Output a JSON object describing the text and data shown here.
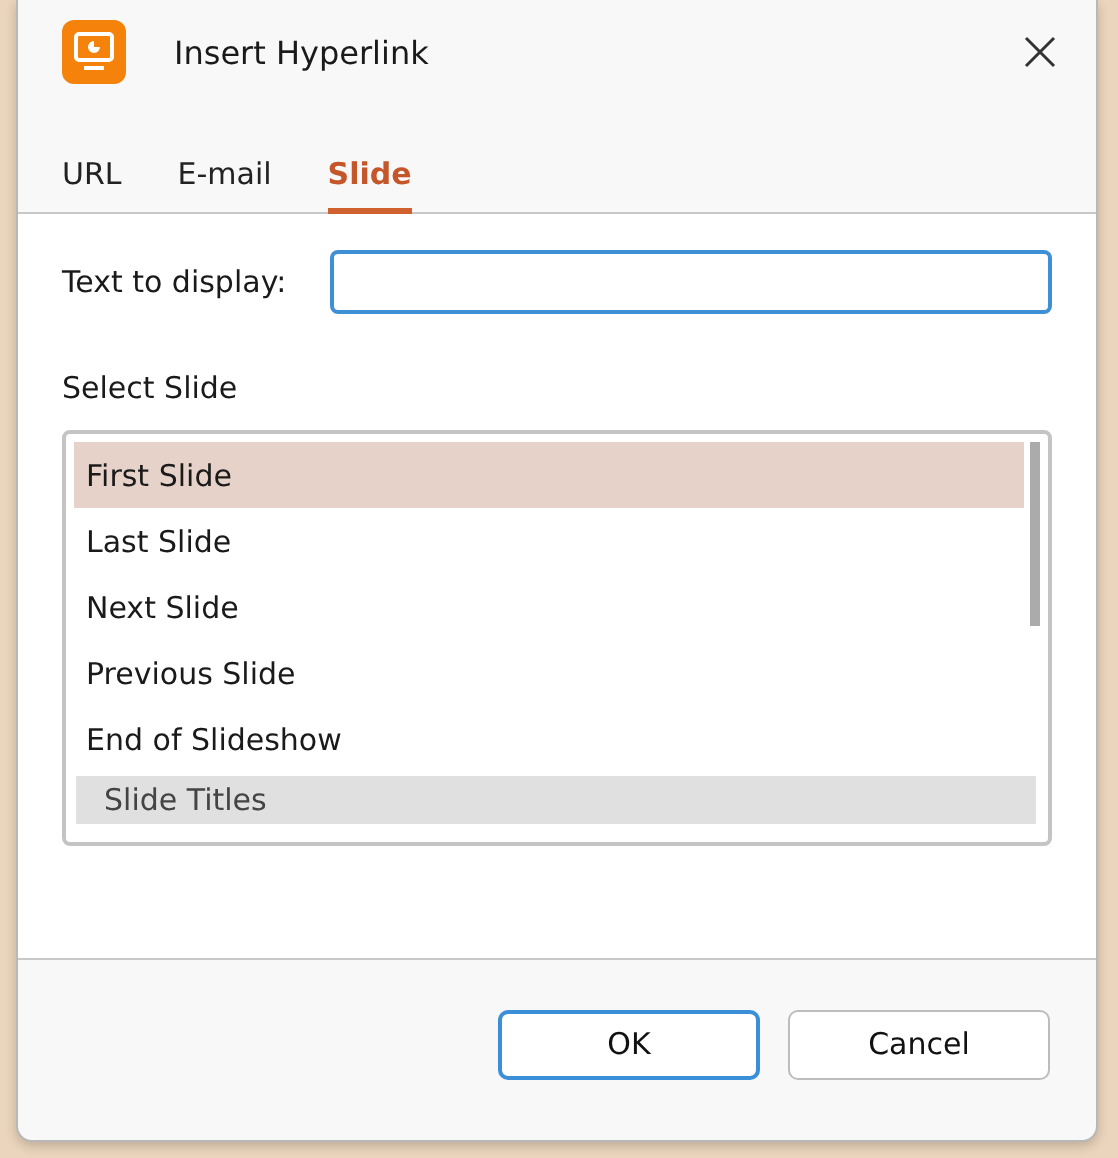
{
  "window": {
    "title": "Insert Hyperlink"
  },
  "tabs": [
    {
      "label": "URL",
      "selected": false
    },
    {
      "label": "E-mail",
      "selected": false
    },
    {
      "label": "Slide",
      "selected": true
    }
  ],
  "text_to_display": {
    "label": "Text to display:"
  },
  "select_slide": {
    "label": "Select Slide",
    "items": [
      {
        "label": "First Slide",
        "kind": "item",
        "selected": true
      },
      {
        "label": "Last Slide",
        "kind": "item",
        "selected": false
      },
      {
        "label": "Next Slide",
        "kind": "item",
        "selected": false
      },
      {
        "label": "Previous Slide",
        "kind": "item",
        "selected": false
      },
      {
        "label": "End of Slideshow",
        "kind": "item",
        "selected": false
      },
      {
        "label": "Slide Titles",
        "kind": "group"
      }
    ]
  },
  "buttons": [
    {
      "label": "OK",
      "kind": "default"
    },
    {
      "label": "Cancel",
      "kind": "normal"
    }
  ]
}
